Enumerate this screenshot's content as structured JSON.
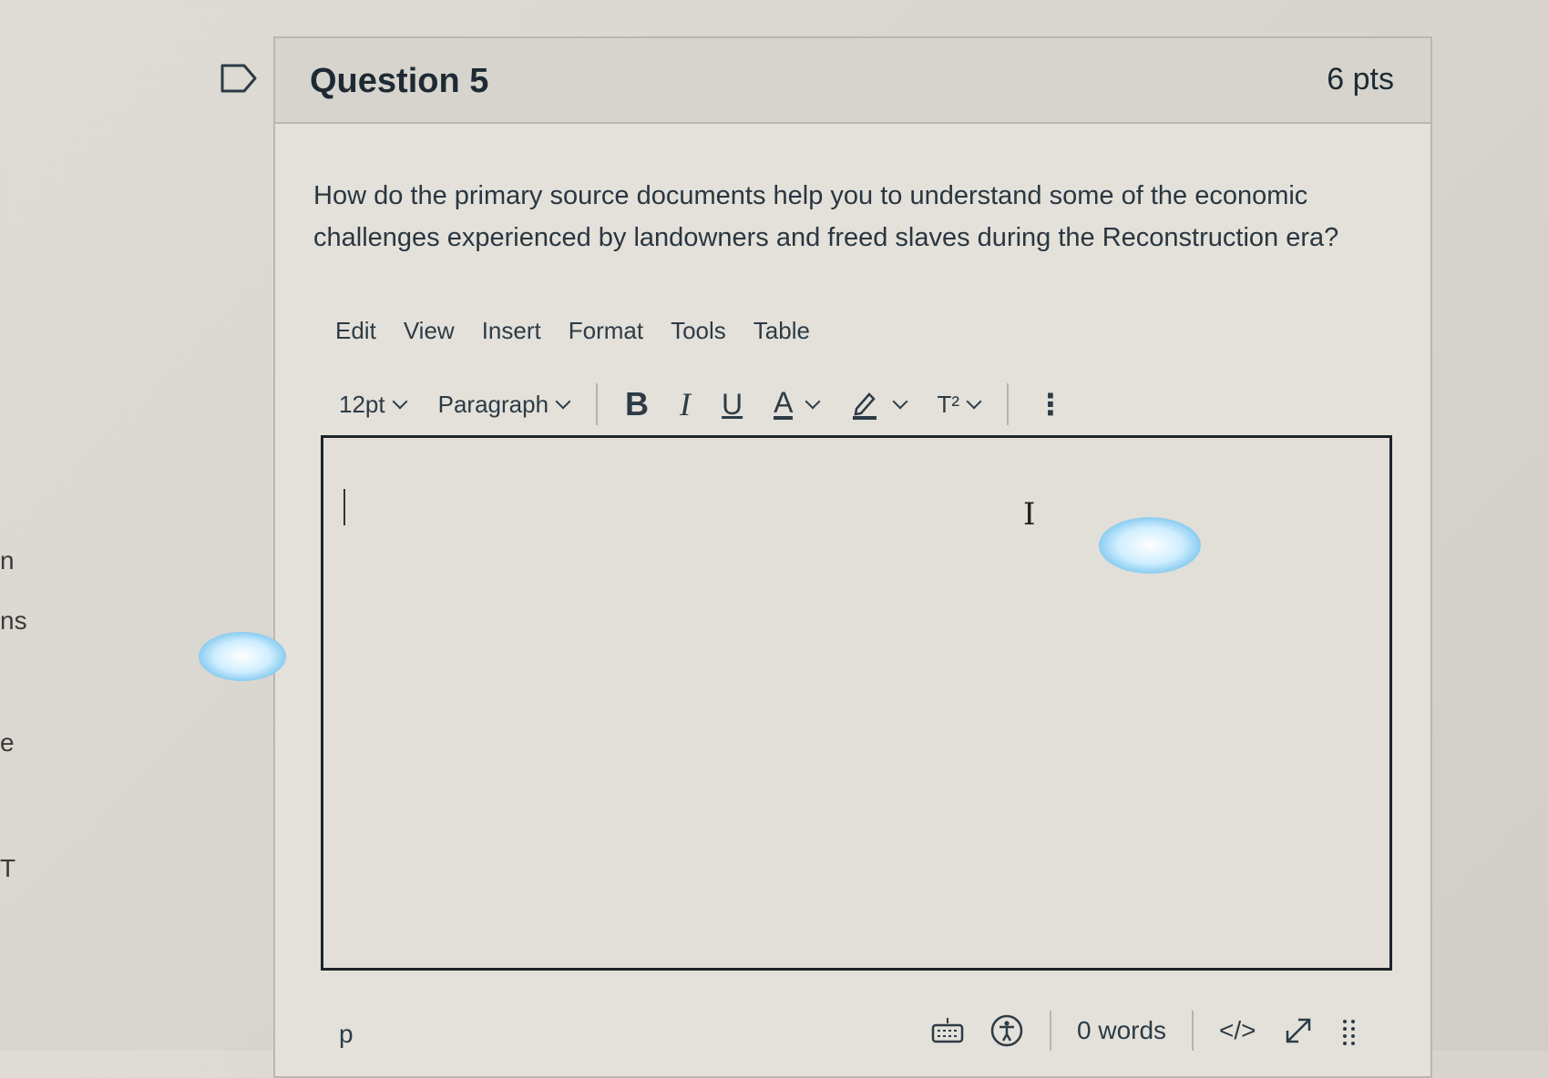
{
  "side_fragments": [
    "n",
    "ns",
    "e",
    "T"
  ],
  "question": {
    "title": "Question 5",
    "points": "6 pts",
    "text": "How do the primary source documents help you to understand some of the economic challenges experienced by landowners and freed slaves during the Reconstruction era?"
  },
  "editor": {
    "menu": [
      "Edit",
      "View",
      "Insert",
      "Format",
      "Tools",
      "Table"
    ],
    "toolbar": {
      "font_size": "12pt",
      "block_format": "Paragraph",
      "bold": "B",
      "italic": "I",
      "underline": "U",
      "text_color": "A",
      "superscript": "T²"
    },
    "content": "",
    "status": {
      "path": "p",
      "word_count": "0 words",
      "html_toggle": "</>"
    }
  },
  "colors": {
    "card_bg": "#e3e1da",
    "header_bg": "#d6d4cd",
    "text": "#2d3b45"
  }
}
